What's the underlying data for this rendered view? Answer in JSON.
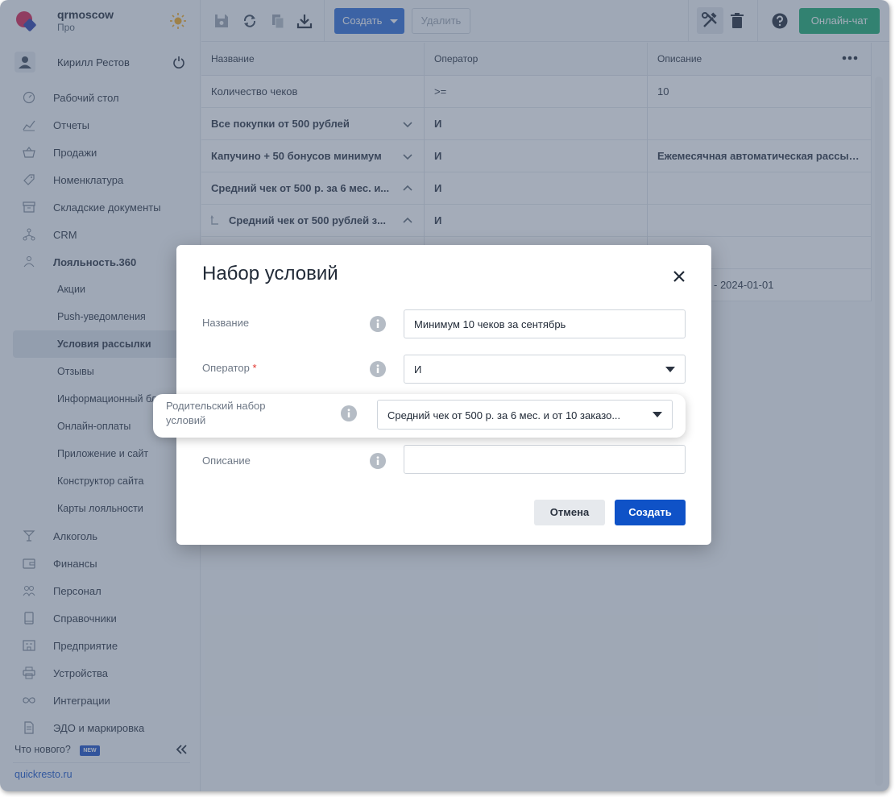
{
  "brand": {
    "name": "qrmoscow",
    "plan": "Про"
  },
  "user": {
    "name": "Кирилл Рестов"
  },
  "sidebar": {
    "items": [
      {
        "label": "Рабочий стол",
        "icon": "dashboard-icon"
      },
      {
        "label": "Отчеты",
        "icon": "chart-icon"
      },
      {
        "label": "Продажи",
        "icon": "basket-icon"
      },
      {
        "label": "Номенклатура",
        "icon": "tag-icon"
      },
      {
        "label": "Складские документы",
        "icon": "archive-icon"
      },
      {
        "label": "CRM",
        "icon": "crm-icon"
      },
      {
        "label": "Лояльность.360",
        "icon": "loyalty-icon"
      },
      {
        "label": "Акции"
      },
      {
        "label": "Push-уведомления"
      },
      {
        "label": "Условия рассылки"
      },
      {
        "label": "Отзывы"
      },
      {
        "label": "Информационный бл"
      },
      {
        "label": "Онлайн-оплаты"
      },
      {
        "label": "Приложение и сайт"
      },
      {
        "label": "Конструктор сайта"
      },
      {
        "label": "Карты лояльности"
      },
      {
        "label": "Алкоголь",
        "icon": "glass-icon"
      },
      {
        "label": "Финансы",
        "icon": "wallet-icon"
      },
      {
        "label": "Персонал",
        "icon": "people-icon"
      },
      {
        "label": "Справочники",
        "icon": "book-icon"
      },
      {
        "label": "Предприятие",
        "icon": "building-icon"
      },
      {
        "label": "Устройства",
        "icon": "printer-icon"
      },
      {
        "label": "Интеграции",
        "icon": "infinity-icon"
      },
      {
        "label": "ЭДО и маркировка",
        "icon": "document-icon"
      }
    ],
    "whats_new": "Что нового?",
    "new_badge": "NEW",
    "site_link": "quickresto.ru"
  },
  "toolbar": {
    "create_label": "Создать",
    "delete_label": "Удалить",
    "chat_label": "Онлайн-чат"
  },
  "table": {
    "headers": [
      "Название",
      "Оператор",
      "Описание"
    ],
    "rows": [
      {
        "name": "Количество чеков",
        "operator": ">=",
        "description": "10"
      },
      {
        "name": "Все покупки от 500 рублей",
        "operator": "И",
        "description": ""
      },
      {
        "name": "Капучино + 50 бонусов минимум",
        "operator": "И",
        "description": "Ежемесячная автоматическая рассыл..."
      },
      {
        "name": "Средний чек от 500 р. за 6 мес. и...",
        "operator": "И",
        "description": ""
      },
      {
        "name": "Средний чек от 500 рублей з...",
        "operator": "И",
        "description": ""
      },
      {
        "name": "",
        "operator": "",
        "description": ""
      },
      {
        "name": "",
        "operator": "",
        "description": "- 2024-01-01"
      }
    ]
  },
  "modal": {
    "title": "Набор условий",
    "name_label": "Название",
    "name_value": "Минимум 10 чеков за сентябрь",
    "operator_label": "Оператор",
    "operator_required": "*",
    "operator_value": "И",
    "parent_label": "Родительский набор условий",
    "parent_value": "Средний чек от 500 р. за 6 мес. и от 10 заказо...",
    "description_label": "Описание",
    "description_value": "",
    "cancel_label": "Отмена",
    "submit_label": "Создать"
  },
  "colors": {
    "primary": "#0f52c7",
    "create": "#2f6cd6",
    "chat": "#1aab6f",
    "required": "#e0322b",
    "overlay": "#4a5a73"
  }
}
